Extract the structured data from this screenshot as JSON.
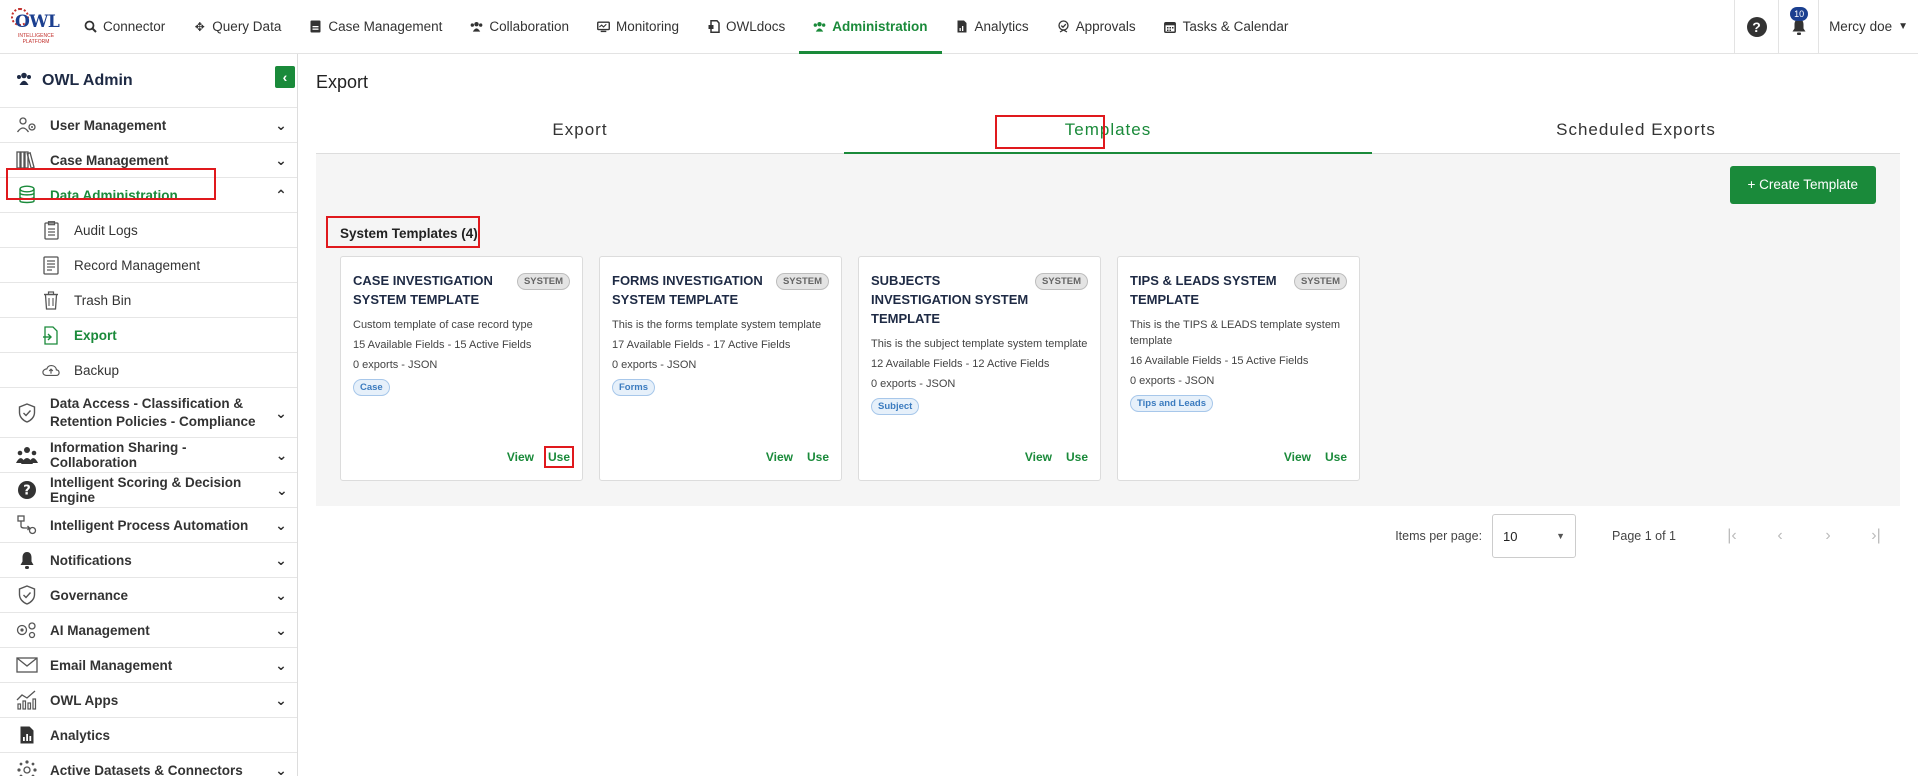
{
  "app": {
    "logo_text": "OWL",
    "logo_sub": "INTELLIGENCE PLATFORM",
    "nav": [
      {
        "label": "Connector",
        "icon": "search-icon"
      },
      {
        "label": "Query Data",
        "icon": "move-icon"
      },
      {
        "label": "Case Management",
        "icon": "briefcase-icon"
      },
      {
        "label": "Collaboration",
        "icon": "users-icon"
      },
      {
        "label": "Monitoring",
        "icon": "monitor-icon"
      },
      {
        "label": "OWLdocs",
        "icon": "doc-icon"
      },
      {
        "label": "Administration",
        "icon": "admin-users-icon"
      },
      {
        "label": "Analytics",
        "icon": "file-chart-icon"
      },
      {
        "label": "Approvals",
        "icon": "approval-icon"
      },
      {
        "label": "Tasks & Calendar",
        "icon": "calendar-icon"
      }
    ],
    "notifications_count": "10",
    "user_name": "Mercy doe"
  },
  "sidebar": {
    "title": "OWL Admin",
    "items": [
      {
        "label": "User Management"
      },
      {
        "label": "Case Management"
      },
      {
        "label": "Data Administration"
      },
      {
        "label": "Data Access - Classification & Retention Policies - Compliance"
      },
      {
        "label": "Information Sharing - Collaboration"
      },
      {
        "label": "Intelligent Scoring & Decision Engine"
      },
      {
        "label": "Intelligent Process Automation"
      },
      {
        "label": "Notifications"
      },
      {
        "label": "Governance"
      },
      {
        "label": "AI Management"
      },
      {
        "label": "Email Management"
      },
      {
        "label": "OWL Apps"
      },
      {
        "label": "Analytics"
      },
      {
        "label": "Active Datasets & Connectors"
      }
    ],
    "sub_items": [
      {
        "label": "Audit Logs"
      },
      {
        "label": "Record Management"
      },
      {
        "label": "Trash Bin"
      },
      {
        "label": "Export"
      },
      {
        "label": "Backup"
      }
    ]
  },
  "main": {
    "page_title": "Export",
    "tabs": [
      {
        "label": "Export"
      },
      {
        "label": "Templates"
      },
      {
        "label": "Scheduled Exports"
      }
    ],
    "create_button": "+ Create Template",
    "section_title": "System Templates (4)",
    "cards": [
      {
        "title": "CASE INVESTIGATION SYSTEM TEMPLATE",
        "badge": "SYSTEM",
        "description": "Custom template of case record type",
        "fields": "15 Available Fields  -  15 Active Fields",
        "exports": "0 exports  -  JSON",
        "tag": "Case",
        "view": "View",
        "use": "Use"
      },
      {
        "title": "FORMS INVESTIGATION SYSTEM TEMPLATE",
        "badge": "SYSTEM",
        "description": "This is the forms template system template",
        "fields": "17 Available Fields  -  17 Active Fields",
        "exports": "0 exports  -  JSON",
        "tag": "Forms",
        "view": "View",
        "use": "Use"
      },
      {
        "title": "SUBJECTS INVESTIGATION SYSTEM TEMPLATE",
        "badge": "SYSTEM",
        "description": "This is the subject template system template",
        "fields": "12 Available Fields  -  12 Active Fields",
        "exports": "0 exports  -  JSON",
        "tag": "Subject",
        "view": "View",
        "use": "Use"
      },
      {
        "title": "TIPS & LEADS SYSTEM TEMPLATE",
        "badge": "SYSTEM",
        "description": "This is the TIPS & LEADS template system template",
        "fields": "16 Available Fields  -  15 Active Fields",
        "exports": "0 exports  -  JSON",
        "tag": "Tips and Leads",
        "view": "View",
        "use": "Use"
      }
    ],
    "pager": {
      "items_per_page_label": "Items per page:",
      "items_per_page_value": "10",
      "page_info": "Page 1 of 1"
    }
  },
  "colors": {
    "accent": "#1a8a3a",
    "highlight": "#e0191d",
    "title_navy": "#1e2a44"
  }
}
